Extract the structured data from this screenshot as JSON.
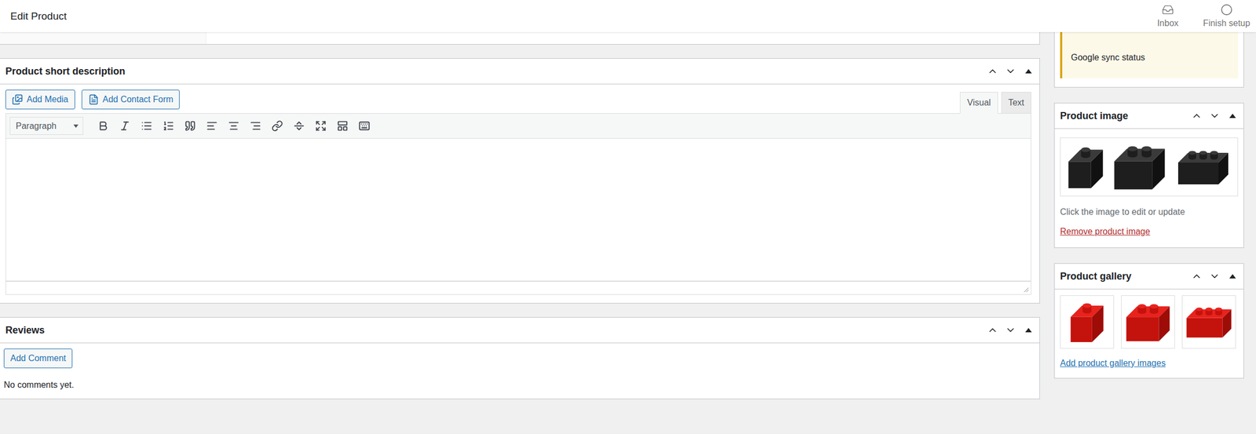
{
  "header": {
    "title": "Edit Product",
    "actions": [
      {
        "label": "Inbox",
        "kind": "inbox"
      },
      {
        "label": "Finish setup",
        "kind": "progress"
      }
    ]
  },
  "short_description": {
    "title": "Product short description",
    "media_buttons": [
      {
        "label": "Add Media",
        "kind": "media"
      },
      {
        "label": "Add Contact Form",
        "kind": "form"
      }
    ],
    "tabs": [
      {
        "label": "Visual",
        "selected": true
      },
      {
        "label": "Text",
        "selected": false
      }
    ],
    "format": "Paragraph",
    "content": ""
  },
  "reviews": {
    "title": "Reviews",
    "button": "Add Comment",
    "empty": "No comments yet."
  },
  "sidebar": {
    "notice": "Google sync status",
    "product_image": {
      "title": "Product image",
      "hint": "Click the image to edit or update",
      "remove_link": "Remove product image"
    },
    "gallery": {
      "title": "Product gallery",
      "images": [
        {
          "kind": "photo"
        },
        {
          "kind": "photo"
        },
        {
          "kind": "photo"
        }
      ],
      "add_link": "Add product gallery images"
    }
  }
}
